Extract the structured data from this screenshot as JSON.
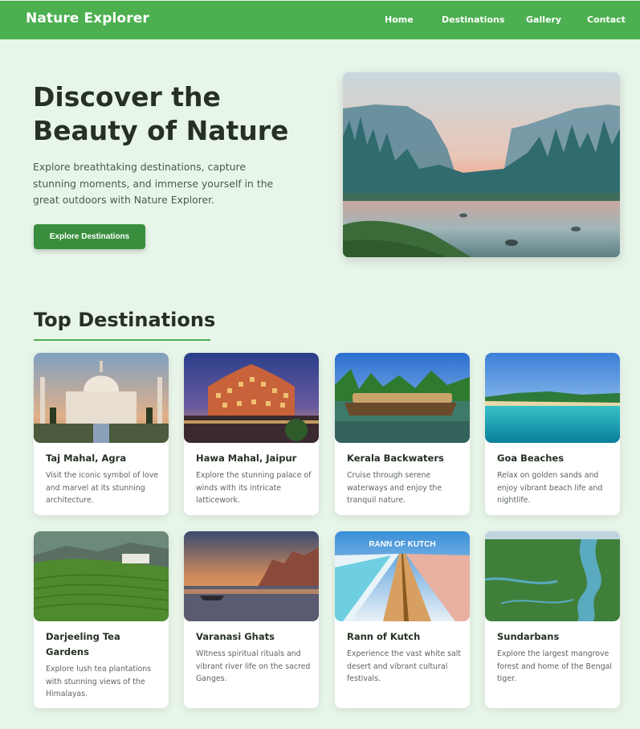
{
  "nav": {
    "brand": "Nature Explorer",
    "links": [
      "Home",
      "Destinations",
      "Gallery",
      "Contact"
    ]
  },
  "hero": {
    "title": "Discover the Beauty of Nature",
    "description": "Explore breathtaking destinations, capture stunning moments, and immerse yourself in the great outdoors with Nature Explorer.",
    "button": "Explore Destinations"
  },
  "section": {
    "title": "Top Destinations"
  },
  "destinations": [
    {
      "title": "Taj Mahal, Agra",
      "desc": "Visit the iconic symbol of love and marvel at its stunning architecture."
    },
    {
      "title": "Hawa Mahal, Jaipur",
      "desc": "Explore the stunning palace of winds with its intricate latticework."
    },
    {
      "title": "Kerala Backwaters",
      "desc": "Cruise through serene waterways and enjoy the tranquil nature."
    },
    {
      "title": "Goa Beaches",
      "desc": "Relax on golden sands and enjoy vibrant beach life and nightlife."
    },
    {
      "title": "Darjeeling Tea Gardens",
      "desc": "Explore lush tea plantations with stunning views of the Himalayas."
    },
    {
      "title": "Varanasi Ghats",
      "desc": "Witness spiritual rituals and vibrant river life on the sacred Ganges."
    },
    {
      "title": "Rann of Kutch",
      "desc": "Experience the vast white salt desert and vibrant cultural festivals.",
      "image_caption": "RANN OF KUTCH"
    },
    {
      "title": "Sundarbans",
      "desc": "Explore the largest mangrove forest and home of the Bengal tiger."
    }
  ],
  "colors": {
    "nav_bg": "#4caf50",
    "page_bg": "#e8f5e9",
    "button_bg": "#388e3c",
    "heading": "#263126"
  }
}
